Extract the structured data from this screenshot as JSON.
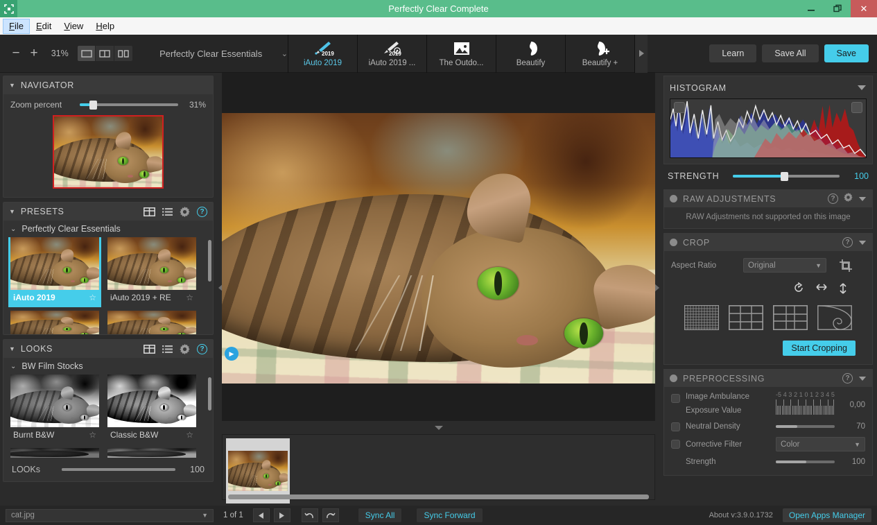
{
  "window": {
    "title": "Perfectly Clear Complete",
    "logo_icon": "frame-icon",
    "minimize_icon": "minimize-icon",
    "restore_icon": "restore-icon",
    "close_icon": "close-icon",
    "titlebar_color": "#59bd8b",
    "close_color": "#c75b5b"
  },
  "menu": {
    "items": [
      "File",
      "Edit",
      "View",
      "Help"
    ],
    "active": "File"
  },
  "toolbar": {
    "zoom_out_icon": "minus-icon",
    "zoom_in_icon": "plus-icon",
    "zoom_percent": "31%",
    "view_modes": [
      {
        "name": "single-view",
        "selected": true
      },
      {
        "name": "split-view",
        "selected": false
      },
      {
        "name": "before-after-view",
        "selected": false
      }
    ],
    "preset_selector": {
      "label": "Perfectly Clear Essentials",
      "chevron_icon": "chevron-down-icon"
    },
    "quick_presets": [
      {
        "label": "iAuto 2019",
        "icon": "brush-2019-icon",
        "active": true
      },
      {
        "label": "iAuto 2019 ...",
        "icon": "brush-lens-2019-icon",
        "active": false
      },
      {
        "label": "The Outdo...",
        "icon": "photo-icon",
        "active": false
      },
      {
        "label": "Beautify",
        "icon": "face-icon",
        "active": false
      },
      {
        "label": "Beautify +",
        "icon": "face-plus-icon",
        "active": false
      }
    ],
    "more_icon": "chevron-right-icon",
    "learn_label": "Learn",
    "save_all_label": "Save All",
    "save_label": "Save",
    "accent_color": "#45cdea"
  },
  "navigator": {
    "title": "NAVIGATOR",
    "collapse_icon": "triangle-down-icon",
    "zoom_label": "Zoom percent",
    "zoom_value": "31%",
    "zoom_fill_pct": 12,
    "thumb_border_color": "#d02020"
  },
  "presets": {
    "title": "PRESETS",
    "collapse_icon": "triangle-down-icon",
    "grid_icon": "grid-view-icon",
    "list_icon": "list-view-icon",
    "gear_icon": "gear-icon",
    "help_icon": "help-icon",
    "group": {
      "label": "Perfectly Clear Essentials",
      "chevron_icon": "chevron-down-icon"
    },
    "items": [
      {
        "label": "iAuto 2019",
        "selected": true,
        "star_icon": "star-icon"
      },
      {
        "label": "iAuto 2019 + RE",
        "selected": false,
        "star_icon": "star-icon"
      },
      {
        "label": "",
        "selected": false,
        "star_icon": "star-icon"
      },
      {
        "label": "",
        "selected": false,
        "star_icon": "star-icon"
      }
    ]
  },
  "looks": {
    "title": "LOOKS",
    "collapse_icon": "triangle-down-icon",
    "grid_icon": "grid-view-icon",
    "list_icon": "list-view-icon",
    "gear_icon": "gear-icon",
    "help_icon": "help-icon",
    "group": {
      "label": "BW Film Stocks",
      "chevron_icon": "chevron-down-icon"
    },
    "items": [
      {
        "label": "Burnt B&W",
        "star_icon": "star-icon"
      },
      {
        "label": "Classic B&W",
        "star_icon": "star-icon"
      }
    ],
    "slider_label": "LOOKs",
    "slider_value": "100",
    "slider_fill_pct": 45
  },
  "canvas": {
    "left_collapse_icon": "triangle-left-icon",
    "right_collapse_icon": "triangle-right-icon",
    "compare_icon": "play-icon",
    "filmstrip_toggle_icon": "triangle-down-icon"
  },
  "histogram": {
    "title": "HISTOGRAM",
    "collapse_icon": "triangle-down-icon",
    "shadow_clip_icon": "shadow-clip-icon",
    "highlight_clip_icon": "highlight-clip-icon"
  },
  "strength": {
    "label": "STRENGTH",
    "value": "100",
    "fill_pct": 48
  },
  "raw_adjustments": {
    "title": "RAW ADJUSTMENTS",
    "toggle_icon": "power-dot-icon",
    "help_icon": "help-icon",
    "gear_icon": "gear-icon",
    "collapse_icon": "triangle-down-icon",
    "message": "RAW Adjustments not supported on this image"
  },
  "crop": {
    "title": "CROP",
    "toggle_icon": "power-dot-icon",
    "help_icon": "help-icon",
    "collapse_icon": "triangle-down-icon",
    "aspect_label": "Aspect Ratio",
    "aspect_value": "Original",
    "aspect_chevron_icon": "chevron-down-icon",
    "crop_tool_icon": "crop-icon",
    "rotate_icon": "rotate-icon",
    "flip_h_icon": "flip-horizontal-icon",
    "flip_v_icon": "flip-vertical-icon",
    "overlays": [
      "fine-grid-icon",
      "thirds-grid-icon",
      "golden-grid-icon",
      "golden-spiral-icon"
    ],
    "start_label": "Start Cropping"
  },
  "preprocessing": {
    "title": "PREPROCESSING",
    "toggle_icon": "power-dot-icon",
    "help_icon": "help-icon",
    "collapse_icon": "triangle-down-icon",
    "image_ambulance": {
      "label": "Image Ambulance",
      "checkbox_icon": "checkbox-icon"
    },
    "exposure": {
      "label": "Exposure Value",
      "value": "0,00",
      "scale": [
        "-5",
        "-4",
        "-3",
        "-2",
        "-1",
        "0",
        "1",
        "2",
        "3",
        "4",
        "5"
      ]
    },
    "neutral_density": {
      "label": "Neutral Density",
      "value": "70",
      "fill_pct": 37,
      "checkbox_icon": "checkbox-icon"
    },
    "corrective_filter": {
      "label": "Corrective Filter",
      "value": "Color",
      "checkbox_icon": "checkbox-icon",
      "chevron_icon": "chevron-down-icon"
    },
    "strength": {
      "label": "Strength",
      "value": "100",
      "fill_pct": 52
    }
  },
  "statusbar": {
    "file_name": "cat.jpg",
    "file_chevron_icon": "chevron-down-icon",
    "page_indicator": "1 of 1",
    "prev_icon": "triangle-left-icon",
    "next_icon": "triangle-right-icon",
    "undo_icon": "undo-icon",
    "redo_icon": "redo-icon",
    "sync_all_label": "Sync All",
    "sync_forward_label": "Sync Forward",
    "about_label": "About v:3.9.0.1732",
    "apps_manager_label": "Open Apps Manager"
  }
}
